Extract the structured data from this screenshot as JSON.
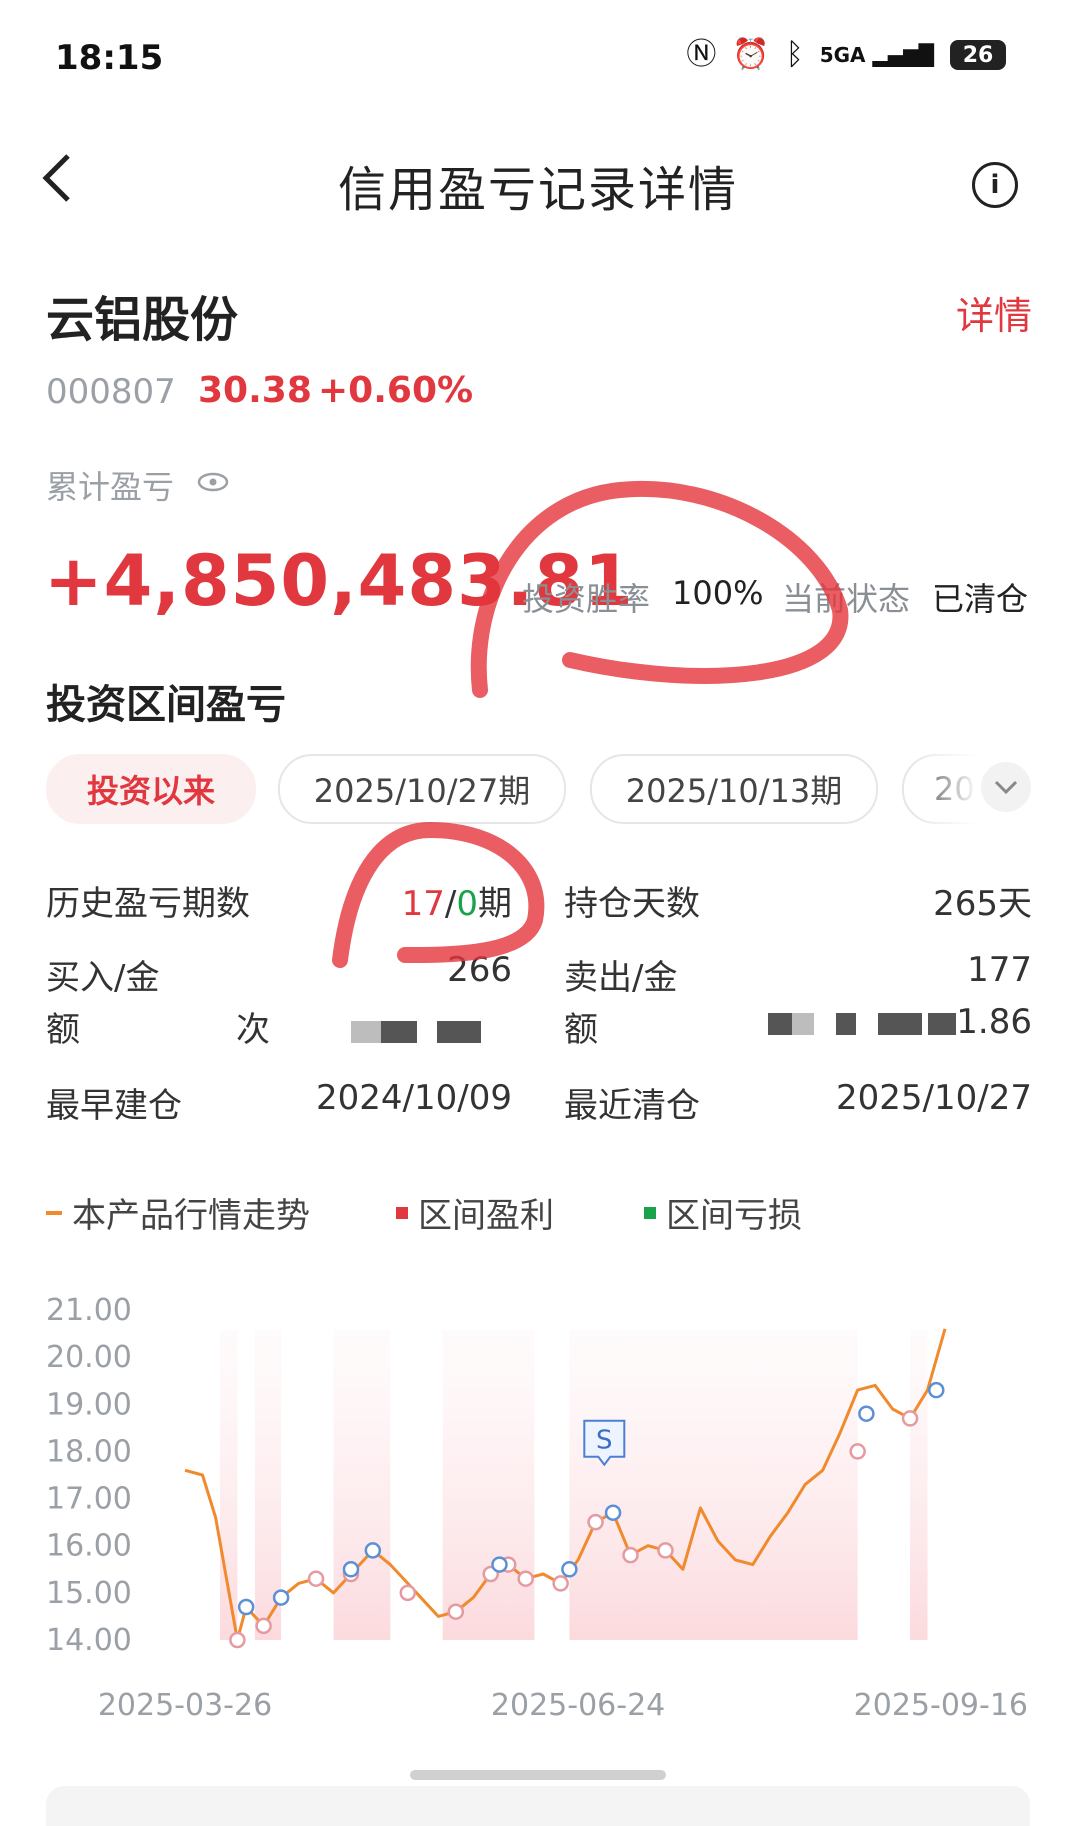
{
  "status_bar": {
    "time": "18:15",
    "network": "5GA",
    "battery": "26",
    "icons": [
      "nfc-icon",
      "alarm-icon",
      "bluetooth-icon",
      "signal-icon",
      "battery-icon"
    ]
  },
  "nav": {
    "title": "信用盈亏记录详情",
    "back_icon": "chevron-left-icon",
    "info_icon": "info-icon"
  },
  "stock": {
    "name": "云铝股份",
    "detail_label": "详情",
    "code": "000807",
    "price": "30.38",
    "change": "+0.60%"
  },
  "summary": {
    "cumulative_label": "累计盈亏",
    "cumulative_value": "+4,850,483.81",
    "win_rate_label": "投资胜率",
    "win_rate_value": "100%",
    "status_label": "当前状态",
    "status_value": "已清仓"
  },
  "section": {
    "title": "投资区间盈亏",
    "tabs": [
      "投资以来",
      "2025/10/27期",
      "2025/10/13期",
      "20"
    ]
  },
  "stats": {
    "periods_label": "历史盈亏期数",
    "periods_win": "17",
    "periods_sep": "/",
    "periods_loss": "0",
    "periods_unit": "期",
    "hold_days_label": "持仓天数",
    "hold_days_value": "265天",
    "buy_label_1": "买入/金",
    "buy_label_2": "额",
    "buy_value_1": "266",
    "buy_value_2": "次",
    "sell_label_1": "卖出/金",
    "sell_label_2": "额",
    "sell_value_1": "177",
    "sell_value_2": "1.86",
    "first_open_label": "最早建仓",
    "first_open_value": "2024/10/09",
    "last_clear_label": "最近清仓",
    "last_clear_value": "2025/10/27"
  },
  "legend": {
    "trend": "本产品行情走势",
    "profit": "区间盈利",
    "loss": "区间亏损",
    "colors": {
      "trend": "#f08a2c",
      "profit": "#e0383e",
      "loss": "#1aa34a"
    }
  },
  "chart_data": {
    "type": "line",
    "title": "",
    "ylim": [
      14.0,
      21.0
    ],
    "y_ticks": [
      "21.00",
      "20.00",
      "19.00",
      "18.00",
      "17.00",
      "16.00",
      "15.00",
      "14.00"
    ],
    "x_ticks": [
      "2025-03-26",
      "2025-06-24",
      "2025-09-16"
    ],
    "x_range": [
      "2025-03-26",
      "2025-09-16"
    ],
    "marker_label": "S",
    "series": [
      {
        "name": "本产品行情走势",
        "color": "#f08a2c",
        "x": [
          "2025-03-26",
          "2025-03-30",
          "2025-04-02",
          "2025-04-07",
          "2025-04-09",
          "2025-04-13",
          "2025-04-17",
          "2025-04-21",
          "2025-04-25",
          "2025-04-29",
          "2025-05-03",
          "2025-05-08",
          "2025-05-12",
          "2025-05-16",
          "2025-05-20",
          "2025-05-23",
          "2025-05-27",
          "2025-05-31",
          "2025-06-04",
          "2025-06-08",
          "2025-06-12",
          "2025-06-16",
          "2025-06-20",
          "2025-06-24",
          "2025-06-28",
          "2025-07-02",
          "2025-07-06",
          "2025-07-10",
          "2025-07-14",
          "2025-07-18",
          "2025-07-22",
          "2025-07-26",
          "2025-07-30",
          "2025-08-03",
          "2025-08-07",
          "2025-08-11",
          "2025-08-15",
          "2025-08-19",
          "2025-08-23",
          "2025-08-27",
          "2025-08-31",
          "2025-09-04",
          "2025-09-08",
          "2025-09-12",
          "2025-09-16"
        ],
        "y": [
          17.6,
          17.5,
          16.6,
          14.0,
          14.7,
          14.3,
          14.9,
          15.2,
          15.3,
          15.0,
          15.4,
          15.9,
          15.6,
          15.2,
          14.8,
          14.5,
          14.6,
          14.9,
          15.4,
          15.6,
          15.3,
          15.4,
          15.2,
          15.7,
          16.5,
          16.7,
          15.8,
          16.0,
          15.9,
          15.5,
          16.8,
          16.1,
          15.7,
          15.6,
          16.2,
          16.7,
          17.3,
          17.6,
          18.4,
          19.3,
          19.4,
          18.9,
          18.7,
          19.3,
          20.6
        ]
      }
    ],
    "profit_points": [
      {
        "x": "2025-04-07",
        "y": 14.0
      },
      {
        "x": "2025-04-13",
        "y": 14.3
      },
      {
        "x": "2025-04-25",
        "y": 15.3
      },
      {
        "x": "2025-05-03",
        "y": 15.4
      },
      {
        "x": "2025-05-16",
        "y": 15.0
      },
      {
        "x": "2025-05-27",
        "y": 14.6
      },
      {
        "x": "2025-06-04",
        "y": 15.4
      },
      {
        "x": "2025-06-08",
        "y": 15.6
      },
      {
        "x": "2025-06-12",
        "y": 15.3
      },
      {
        "x": "2025-06-20",
        "y": 15.2
      },
      {
        "x": "2025-06-28",
        "y": 16.5
      },
      {
        "x": "2025-07-06",
        "y": 15.8
      },
      {
        "x": "2025-07-14",
        "y": 15.9
      },
      {
        "x": "2025-08-27",
        "y": 18.0
      },
      {
        "x": "2025-09-08",
        "y": 18.7
      }
    ],
    "hold_points": [
      {
        "x": "2025-04-09",
        "y": 14.7
      },
      {
        "x": "2025-04-17",
        "y": 14.9
      },
      {
        "x": "2025-05-03",
        "y": 15.5
      },
      {
        "x": "2025-05-08",
        "y": 15.9
      },
      {
        "x": "2025-06-06",
        "y": 15.6
      },
      {
        "x": "2025-06-22",
        "y": 15.5
      },
      {
        "x": "2025-07-02",
        "y": 16.7
      },
      {
        "x": "2025-08-29",
        "y": 18.8
      },
      {
        "x": "2025-09-14",
        "y": 19.3
      }
    ],
    "profit_bands": [
      [
        "2025-04-03",
        "2025-04-07"
      ],
      [
        "2025-04-11",
        "2025-04-17"
      ],
      [
        "2025-04-29",
        "2025-05-12"
      ],
      [
        "2025-05-24",
        "2025-06-14"
      ],
      [
        "2025-06-22",
        "2025-08-27"
      ],
      [
        "2025-09-08",
        "2025-09-12"
      ]
    ],
    "grid": false,
    "legend_position": "top-left"
  }
}
